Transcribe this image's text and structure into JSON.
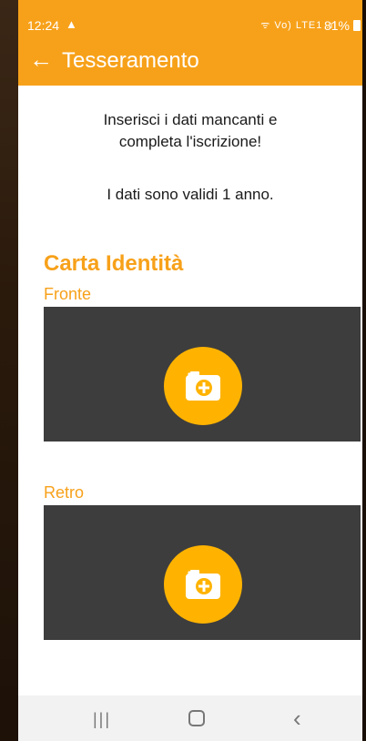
{
  "status_bar": {
    "time": "12:24",
    "warning_icon": "warning-triangle-icon",
    "network_text": "ᯤ Vo) LTE1 .ıl",
    "battery_text": "81%"
  },
  "app_bar": {
    "back_icon": "arrow-left-icon",
    "title": "Tesseramento",
    "color": "#f7a11a"
  },
  "intro": {
    "line1": "Inserisci i dati mancanti e",
    "line2": "completa l'iscrizione!",
    "validity": "I dati sono validi 1 anno."
  },
  "section": {
    "title": "Carta Identità",
    "front_label": "Fronte",
    "back_label": "Retro",
    "camera_icon": "camera-add-icon",
    "accent_color": "#ffb300"
  },
  "nav_bar": {
    "recent_icon": "recent-apps-icon",
    "home_icon": "home-icon",
    "back_icon": "chevron-left-icon"
  }
}
